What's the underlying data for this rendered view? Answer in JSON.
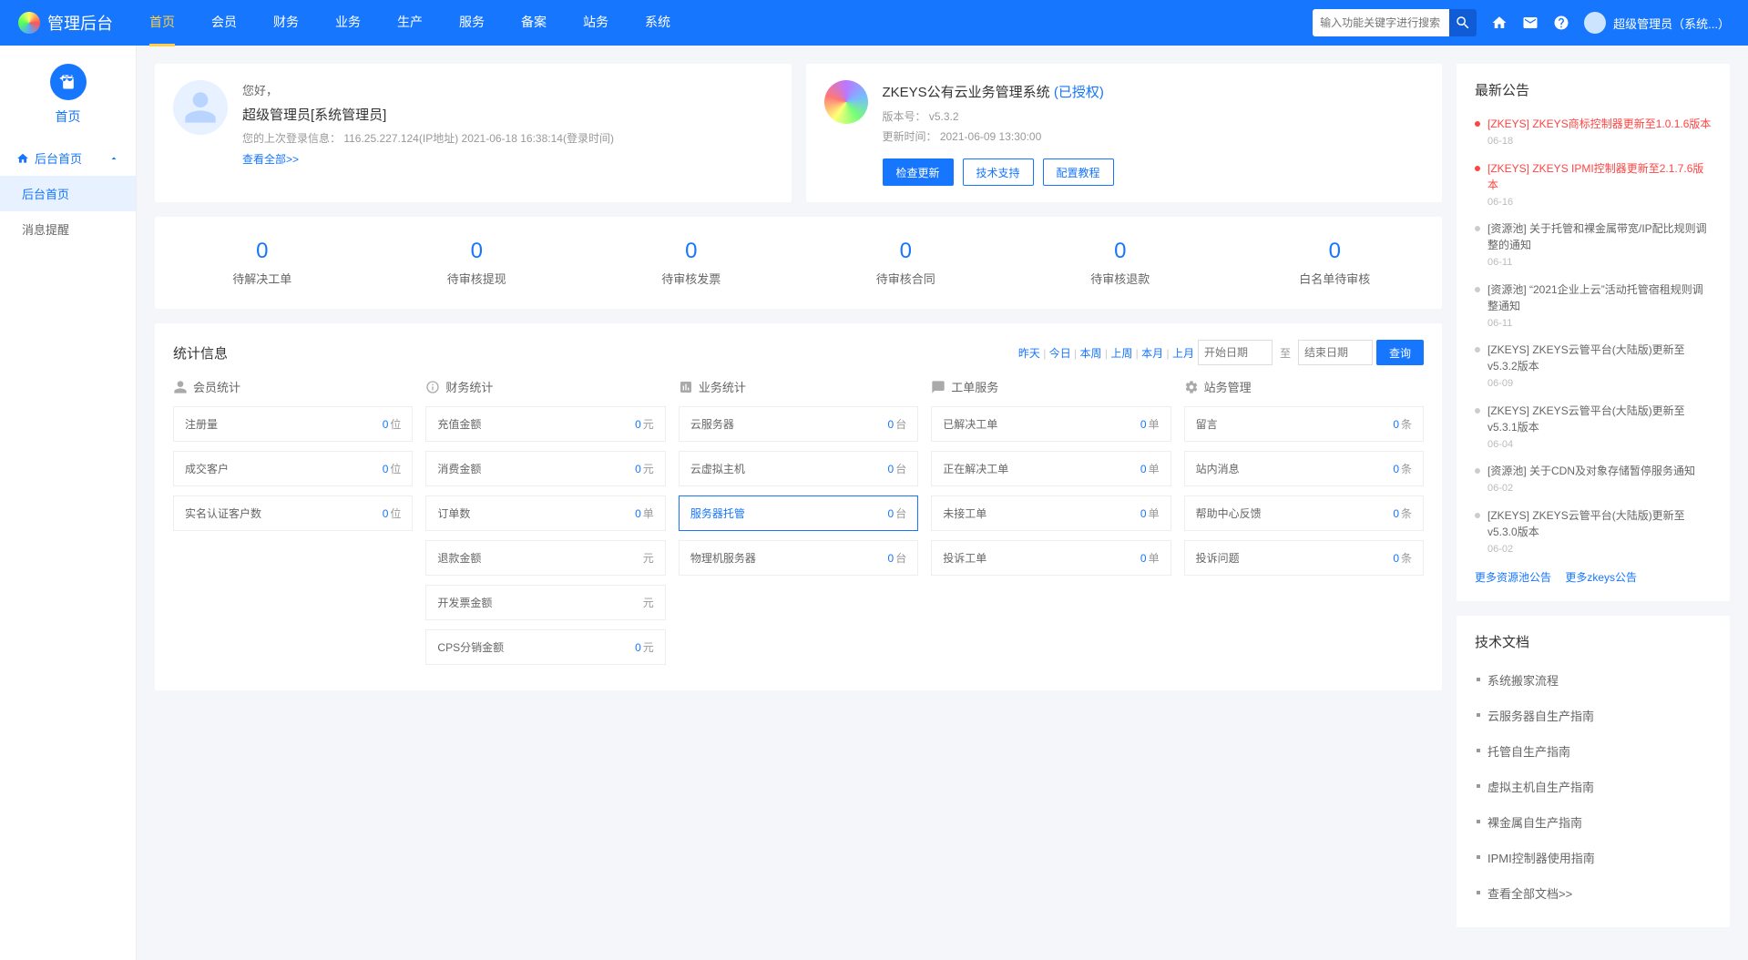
{
  "header": {
    "brand": "管理后台",
    "nav": [
      "首页",
      "会员",
      "财务",
      "业务",
      "生产",
      "服务",
      "备案",
      "站务",
      "系统"
    ],
    "search_placeholder": "输入功能关键字进行搜索",
    "user": "超级管理员（系统...）"
  },
  "sidebar": {
    "top_label": "首页",
    "group": "后台首页",
    "items": [
      "后台首页",
      "消息提醒"
    ]
  },
  "welcome": {
    "greet": "您好，",
    "role": "超级管理员[系统管理员]",
    "login": "您的上次登录信息： 116.25.227.124(IP地址) 2021-06-18 16:38:14(登录时间)",
    "viewall": "查看全部>>"
  },
  "system": {
    "title": "ZKEYS公有云业务管理系统",
    "auth": "(已授权)",
    "version": "版本号： v5.3.2",
    "update": "更新时间： 2021-06-09 13:30:00",
    "btn_check": "检查更新",
    "btn_support": "技术支持",
    "btn_guide": "配置教程"
  },
  "pending": [
    {
      "num": "0",
      "label": "待解决工单"
    },
    {
      "num": "0",
      "label": "待审核提现"
    },
    {
      "num": "0",
      "label": "待审核发票"
    },
    {
      "num": "0",
      "label": "待审核合同"
    },
    {
      "num": "0",
      "label": "待审核退款"
    },
    {
      "num": "0",
      "label": "白名单待审核"
    }
  ],
  "statinfo": {
    "title": "统计信息",
    "ranges": [
      "昨天",
      "今日",
      "本周",
      "上周",
      "本月",
      "上月"
    ],
    "start_ph": "开始日期",
    "end_ph": "结束日期",
    "to": "至",
    "query": "查询",
    "blocks": [
      {
        "head": "会员统计",
        "items": [
          {
            "label": "注册量",
            "val": "0",
            "unit": "位"
          },
          {
            "label": "成交客户",
            "val": "0",
            "unit": "位"
          },
          {
            "label": "实名认证客户数",
            "val": "0",
            "unit": "位"
          }
        ]
      },
      {
        "head": "财务统计",
        "items": [
          {
            "label": "充值金额",
            "val": "0",
            "unit": "元"
          },
          {
            "label": "消费金额",
            "val": "0",
            "unit": "元"
          },
          {
            "label": "订单数",
            "val": "0",
            "unit": "单"
          },
          {
            "label": "退款金额",
            "val": "",
            "unit": "元"
          },
          {
            "label": "开发票金额",
            "val": "",
            "unit": "元"
          },
          {
            "label": "CPS分销金额",
            "val": "0",
            "unit": "元"
          }
        ]
      },
      {
        "head": "业务统计",
        "items": [
          {
            "label": "云服务器",
            "val": "0",
            "unit": "台"
          },
          {
            "label": "云虚拟主机",
            "val": "0",
            "unit": "台"
          },
          {
            "label": "服务器托管",
            "val": "0",
            "unit": "台",
            "hl": true
          },
          {
            "label": "物理机服务器",
            "val": "0",
            "unit": "台"
          }
        ]
      },
      {
        "head": "工单服务",
        "items": [
          {
            "label": "已解决工单",
            "val": "0",
            "unit": "单"
          },
          {
            "label": "正在解决工单",
            "val": "0",
            "unit": "单"
          },
          {
            "label": "未接工单",
            "val": "0",
            "unit": "单"
          },
          {
            "label": "投诉工单",
            "val": "0",
            "unit": "单"
          }
        ]
      },
      {
        "head": "站务管理",
        "items": [
          {
            "label": "留言",
            "val": "0",
            "unit": "条"
          },
          {
            "label": "站内消息",
            "val": "0",
            "unit": "条"
          },
          {
            "label": "帮助中心反馈",
            "val": "0",
            "unit": "条"
          },
          {
            "label": "投诉问题",
            "val": "0",
            "unit": "条"
          }
        ]
      }
    ]
  },
  "ann": {
    "title": "最新公告",
    "items": [
      {
        "text": "[ZKEYS] ZKEYS商标控制器更新至1.0.1.6版本",
        "date": "06-18",
        "hot": true
      },
      {
        "text": "[ZKEYS] ZKEYS IPMI控制器更新至2.1.7.6版本",
        "date": "06-16",
        "hot": true
      },
      {
        "text": "[资源池] 关于托管和裸金属带宽/IP配比规则调整的通知",
        "date": "06-11"
      },
      {
        "text": "[资源池] “2021企业上云”活动托管宿租规则调整通知",
        "date": "06-11"
      },
      {
        "text": "[ZKEYS] ZKEYS云管平台(大陆版)更新至v5.3.2版本",
        "date": "06-09"
      },
      {
        "text": "[ZKEYS] ZKEYS云管平台(大陆版)更新至v5.3.1版本",
        "date": "06-04"
      },
      {
        "text": "[资源池] 关于CDN及对象存储暂停服务通知",
        "date": "06-02"
      },
      {
        "text": "[ZKEYS] ZKEYS云管平台(大陆版)更新至v5.3.0版本",
        "date": "06-02"
      }
    ],
    "more1": "更多资源池公告",
    "more2": "更多zkeys公告"
  },
  "docs": {
    "title": "技术文档",
    "items": [
      "系统搬家流程",
      "云服务器自生产指南",
      "托管自生产指南",
      "虚拟主机自生产指南",
      "裸金属自生产指南",
      "IPMI控制器使用指南",
      "查看全部文档>>"
    ]
  }
}
